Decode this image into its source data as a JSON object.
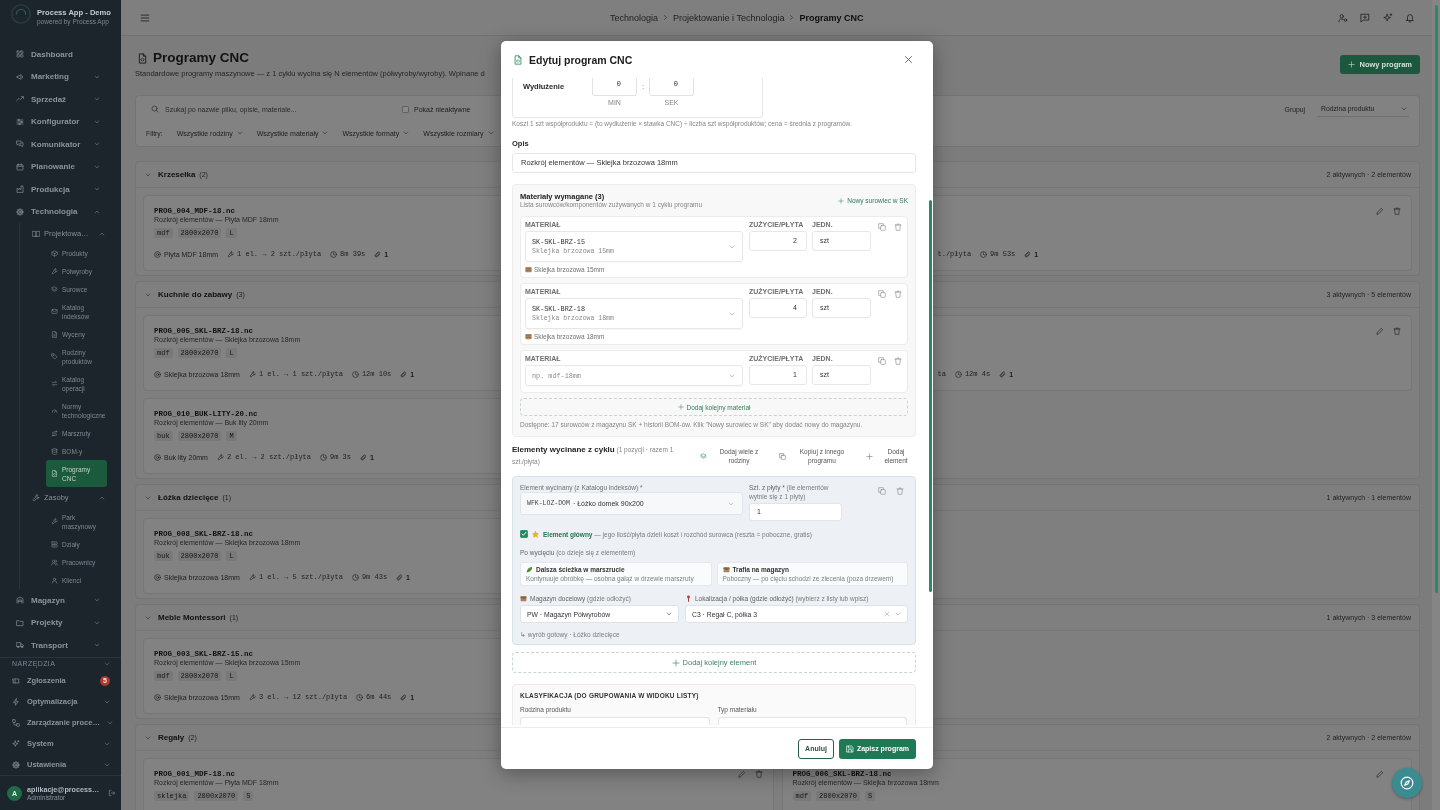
{
  "sidebar": {
    "app_name": "Process App - Demo",
    "app_subtitle": "powered by Process App",
    "sections": [
      {
        "items": [
          {
            "kind": "link",
            "label": "Dashboard",
            "selected": false
          },
          {
            "kind": "group",
            "label": "Marketing",
            "expanded": false
          },
          {
            "kind": "group",
            "label": "Sprzedaż",
            "expanded": false
          },
          {
            "kind": "group",
            "label": "Konfigurator",
            "expanded": false
          },
          {
            "kind": "group",
            "label": "Komunikator",
            "expanded": false
          },
          {
            "kind": "group",
            "label": "Planowanie",
            "expanded": false
          },
          {
            "kind": "group",
            "label": "Produkcja",
            "expanded": false
          },
          {
            "kind": "group",
            "label": "Technologia",
            "expanded": true,
            "children": [
              {
                "label": "Projektowa…",
                "expanded": true,
                "children": [
                  {
                    "label": "Produkty",
                    "selected": false
                  },
                  {
                    "label": "Półwyroby",
                    "selected": false
                  },
                  {
                    "label": "Surowce",
                    "selected": false
                  },
                  {
                    "label": "Katalog indeksów",
                    "selected": false
                  },
                  {
                    "label": "Wyceny",
                    "selected": false
                  },
                  {
                    "label": "Rodziny produktów",
                    "selected": false
                  },
                  {
                    "label": "Katalog operacji",
                    "selected": false
                  },
                  {
                    "label": "Normy technologiczne",
                    "selected": false
                  },
                  {
                    "label": "Marszruty",
                    "selected": false
                  },
                  {
                    "label": "BOM-y",
                    "selected": false
                  },
                  {
                    "label": "Programy CNC",
                    "selected": true
                  }
                ]
              },
              {
                "label": "Zasoby",
                "expanded": true,
                "children": [
                  {
                    "label": "Park maszynowy",
                    "selected": false
                  },
                  {
                    "label": "Działy",
                    "selected": false
                  },
                  {
                    "label": "Pracownicy",
                    "selected": false
                  },
                  {
                    "label": "Klienci",
                    "selected": false
                  }
                ]
              }
            ]
          },
          {
            "kind": "group",
            "label": "Magazyn",
            "expanded": false
          },
          {
            "kind": "group",
            "label": "Projekty",
            "expanded": false
          },
          {
            "kind": "group",
            "label": "Transport",
            "expanded": false
          }
        ]
      },
      {
        "title": "NARZĘDZIA",
        "expanded": true,
        "items": [
          {
            "kind": "link",
            "label": "Zgłoszenia",
            "selected": false,
            "badge": "5"
          },
          {
            "kind": "group",
            "label": "Optymalizacja",
            "expanded": false
          },
          {
            "kind": "group",
            "label": "Zarządzanie proce…",
            "expanded": false
          },
          {
            "kind": "group",
            "label": "System",
            "expanded": false
          },
          {
            "kind": "group",
            "label": "Ustawienia",
            "expanded": false
          }
        ]
      }
    ],
    "user": {
      "initial": "A",
      "email": "aplikacje@process…",
      "role": "Administrator"
    }
  },
  "topbar": {
    "breadcrumb": [
      {
        "label": "Technologia",
        "current": false
      },
      {
        "label": "Projektowanie i Technologia",
        "current": false
      },
      {
        "label": "Programy CNC",
        "current": true
      }
    ]
  },
  "page": {
    "title": "Programy CNC",
    "subtitle": "Standardowe programy maszynowe — z 1 cyklu wycina się N elementów (półwyroby/wyroby). Wpinane d",
    "new_button": "Nowy program"
  },
  "filters": {
    "search": {
      "placeholder": "Szukaj po nazwie pliku, opisie, materiale..."
    },
    "inactive": {
      "label": "Pokaż nieaktywne",
      "checked": false
    },
    "label": "Filtry:",
    "dropdowns": [
      "Wszystkie rodziny",
      "Wszystkie materiały",
      "Wszystkie formaty",
      "Wszystkie rozmiary"
    ],
    "group_label": "Grupuj",
    "group_value": "Rodzina produktu"
  },
  "groups": [
    {
      "name": "Krzesełka",
      "count": "(2)",
      "summary": "2 aktywnych · 2 elementów",
      "expanded": true,
      "programs": [
        {
          "kind": "full",
          "file": "PROG_004_MDF-18.nc",
          "description": "Rozkrój elementów — Płyta MDF 18mm",
          "tags": [
            "mdf",
            "2800x2070",
            "L"
          ],
          "meta": [
            {
              "kind": "material",
              "text": "Płyta MDF 18mm"
            },
            {
              "kind": "elements",
              "text": "1 el. → 2 szt./płyta"
            },
            {
              "kind": "time",
              "text": "8m 39s"
            },
            {
              "kind": "files",
              "text": "1"
            }
          ]
        },
        {
          "kind": "partial",
          "actions": [
            {
              "kind": "edit"
            },
            {
              "kind": "delete"
            }
          ],
          "meta": [
            {
              "kind": "cut",
              "text": "t./płyta"
            },
            {
              "kind": "time",
              "text": "9m 53s"
            },
            {
              "kind": "files",
              "text": "1"
            }
          ]
        }
      ]
    },
    {
      "name": "Kuchnie do zabawy",
      "count": "(3)",
      "summary": "3 aktywnych · 5 elementów",
      "expanded": true,
      "programs": [
        {
          "kind": "full",
          "file": "PROG_005_SKL-BRZ-18.nc",
          "description": "Rozkrój elementów — Sklejka brzozowa 18mm",
          "tags": [
            "mdf",
            "2800x2070",
            "L"
          ],
          "meta": [
            {
              "kind": "material",
              "text": "Sklejka brzozowa 18mm"
            },
            {
              "kind": "elements",
              "text": "1 el. → 1 szt./płyta"
            },
            {
              "kind": "time",
              "text": "12m 10s"
            },
            {
              "kind": "files",
              "text": "1"
            }
          ]
        },
        {
          "kind": "partial",
          "actions": [
            {
              "kind": "edit"
            },
            {
              "kind": "delete"
            }
          ],
          "meta": [
            {
              "kind": "cut",
              "text": "ta"
            },
            {
              "kind": "time",
              "text": "12m 4s"
            },
            {
              "kind": "files",
              "text": "1"
            }
          ]
        },
        {
          "kind": "full",
          "file": "PROG_010_BUK-LITY-20.nc",
          "description": "Rozkrój elementów — Buk lity 20mm",
          "tags": [
            "buk",
            "2800x2070",
            "M"
          ],
          "meta": [
            {
              "kind": "material",
              "text": "Buk lity 20mm"
            },
            {
              "kind": "elements",
              "text": "2 el. → 2 szt./płyta"
            },
            {
              "kind": "time",
              "text": "9m 3s"
            },
            {
              "kind": "files",
              "text": "1"
            }
          ]
        }
      ]
    },
    {
      "name": "Łóżka dziecięce",
      "count": "(1)",
      "summary": "1 aktywnych · 1 elementów",
      "expanded": true,
      "programs": [
        {
          "kind": "full",
          "file": "PROG_008_SKL-BRZ-18.nc",
          "description": "Rozkrój elementów — Sklejka brzozowa 18mm",
          "tags": [
            "buk",
            "2800x2070",
            "L"
          ],
          "meta": [
            {
              "kind": "material",
              "text": "Sklejka brzozowa 18mm"
            },
            {
              "kind": "elements",
              "text": "1 el. → 5 szt./płyta"
            },
            {
              "kind": "time",
              "text": "9m 43s"
            },
            {
              "kind": "files",
              "text": "1"
            }
          ]
        }
      ]
    },
    {
      "name": "Meble Montessori",
      "count": "(1)",
      "summary": "1 aktywnych · 3 elementów",
      "expanded": true,
      "programs": [
        {
          "kind": "full",
          "file": "PROG_003_SKL-BRZ-15.nc",
          "description": "Rozkrój elementów — Sklejka brzozowa 15mm",
          "tags": [
            "mdf",
            "2800x2070",
            "L"
          ],
          "meta": [
            {
              "kind": "material",
              "text": "Sklejka brzozowa 15mm"
            },
            {
              "kind": "elements",
              "text": "3 el. → 12 szt./płyta"
            },
            {
              "kind": "time",
              "text": "6m 44s"
            },
            {
              "kind": "files",
              "text": "1"
            }
          ]
        }
      ]
    },
    {
      "name": "Regały",
      "count": "(2)",
      "summary": "2 aktywnych · 2 elementów",
      "expanded": true,
      "programs": [
        {
          "kind": "full",
          "file": "PROG_001_MDF-18.nc",
          "description": "Rozkrój elementów — Płyta MDF 18mm",
          "tags": [
            "sklejka",
            "2800x2070",
            "S"
          ],
          "actions": [
            {
              "kind": "edit"
            },
            {
              "kind": "delete"
            }
          ]
        },
        {
          "kind": "full",
          "file": "PROG_006_SKL-BRZ-18.nc",
          "description": "Rozkrój elementów — Sklejka brzozowa 18mm",
          "tags": [
            "mdf",
            "2800x2070",
            "S"
          ],
          "actions": [
            {
              "kind": "edit"
            }
          ]
        }
      ]
    }
  ],
  "modal": {
    "title": "Edytuj program CNC",
    "extension": {
      "label": "Wydłużenie",
      "minutes": "0",
      "separator": ":",
      "seconds": "0",
      "min_label": "MIN",
      "sec_label": "SEK"
    },
    "cost_note": "Koszt 1 szt współproduktu = (to wydłużenie × stawka CNC) ÷ liczba szt współproduktów; cena = średnia z programów.",
    "description": {
      "label": "Opis",
      "value": "Rozkrój elementów — Sklejka brzozowa 18mm"
    },
    "materials": {
      "title": "Materiały wymagane (3)",
      "subtitle": "Lista surowców/komponentów zużywanych w 1 cyklu programu",
      "new_link": "Nowy surowiec w SK",
      "rows": [
        {
          "material_label": "MATERIAŁ",
          "usage_label": "ZUŻYCIE/PŁYTA",
          "unit_label": "JEDN.",
          "code": "SK-SKL-BRZ-15",
          "name": "Sklejka brzozowa 15mm",
          "usage": "2",
          "unit": "szt",
          "chip": "Sklejka brzozowa 15mm"
        },
        {
          "material_label": "MATERIAŁ",
          "usage_label": "ZUŻYCIE/PŁYTA",
          "unit_label": "JEDN.",
          "code": "SK-SKL-BRZ-18",
          "name": "Sklejka brzozowa 18mm",
          "usage": "4",
          "unit": "szt",
          "chip": "Sklejka brzozowa 18mm"
        },
        {
          "material_label": "MATERIAŁ",
          "usage_label": "ZUŻYCIE/PŁYTA",
          "unit_label": "JEDN.",
          "placeholder": "np. mdf-18mm",
          "usage": "1",
          "unit": "szt"
        }
      ],
      "add_button": "Dodaj kolejny materiał",
      "note": "Dostępne: 17 surowców z magazynu SK + historii BOM-ów. Klik \"Nowy surowiec w SK\" aby dodać nowy do magazynu."
    },
    "elements": {
      "title": "Elementy wycinane z cyklu",
      "summary": "(1 pozycji · razem 1 szt./płyta)",
      "actions": [
        {
          "kind": "family",
          "label": "Dodaj wiele z rodziny"
        },
        {
          "kind": "copy",
          "label": "Kopiuj z innego programu"
        },
        {
          "kind": "add",
          "label": "Dodaj element"
        }
      ],
      "items": [
        {
          "element_label": "Element wycinany (z Katalogu indeksów) *",
          "code": "WFK-LOZ-DOM",
          "name": "· Łóżko domek 90x200",
          "qty_label": "Szt. z płyty *",
          "qty_hint": "(ile elementów wytnie się z 1 płyty)",
          "qty": "1",
          "main": {
            "checked": true,
            "label": "Element główny",
            "text": "— jego ilość/płyta dzieli koszt i rozchód surowca (reszta = poboczne, gratis)"
          },
          "after_label": "Po wycięciu",
          "after_hint": "(co dzieje się z elementem)",
          "options": [
            {
              "kind": "route",
              "title": "Dalsza ścieżka w marszrucie",
              "text": "Kontynuuje obróbkę — osobna gałąź w drzewie marszruty"
            },
            {
              "kind": "warehouse",
              "title": "Trafia na magazyn",
              "text": "Poboczny — po cięciu schodzi ze zlecenia (poza drzewem)"
            }
          ],
          "warehouse": {
            "label": "Magazyn docelowy",
            "hint": "(gdzie odłożyć)",
            "value": "PW · Magazyn Półwyrobów"
          },
          "location": {
            "label": "Lokalizacja / półka (gdzie odłożyć)",
            "hint": "(wybierz z listy lub wpisz)",
            "value": "C3 · Regał C, półka 3"
          },
          "tags": "↳ wyrób gotowy · Łóżko dziecięce"
        }
      ],
      "add_button": "Dodaj kolejny element"
    },
    "classification": {
      "title": "KLASYFIKACJA (DO GRUPOWANIA W WIDOKU LISTY)",
      "fields": [
        {
          "label": "Rodzina produktu"
        },
        {
          "label": "Typ materiału"
        }
      ]
    },
    "buttons": [
      {
        "kind": "secondary",
        "label": "Anuluj"
      },
      {
        "kind": "primary",
        "label": "Zapisz program"
      }
    ]
  }
}
